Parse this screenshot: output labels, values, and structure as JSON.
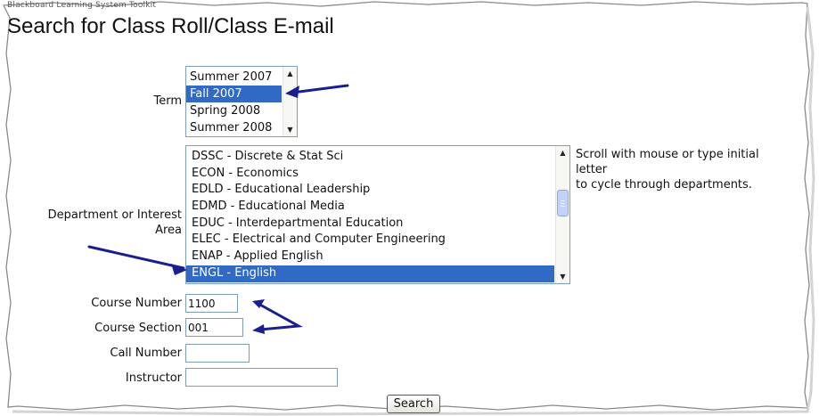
{
  "breadcrumb": "Blackboard Learning System Toolkit",
  "page_title": "Search for Class Roll/Class E-mail",
  "term": {
    "label": "Term",
    "options": [
      "Summer 2007",
      "Fall 2007",
      "Spring 2008",
      "Summer 2008"
    ],
    "selected": "Fall 2007"
  },
  "department": {
    "label_line1": "Department or Interest",
    "label_line2": "Area",
    "options": [
      "DSSC - Discrete & Stat Sci",
      "ECON - Economics",
      "EDLD - Educational Leadership",
      "EDMD - Educational Media",
      "EDUC - Interdepartmental Education",
      "ELEC - Electrical and Computer Engineering",
      "ENAP - Applied English",
      "ENGL - English"
    ],
    "selected": "ENGL - English",
    "hint_line1": "Scroll with mouse or type initial",
    "hint_line2": "letter",
    "hint_line3": "to cycle through departments."
  },
  "course_number": {
    "label": "Course Number",
    "value": "1100"
  },
  "course_section": {
    "label": "Course Section",
    "value": "001"
  },
  "call_number": {
    "label": "Call Number",
    "value": ""
  },
  "instructor": {
    "label": "Instructor",
    "value": ""
  },
  "search_button": "Search",
  "colors": {
    "selection": "#316ac5",
    "annotation_arrow": "#1a1f8f",
    "input_border": "#7f9db9"
  }
}
